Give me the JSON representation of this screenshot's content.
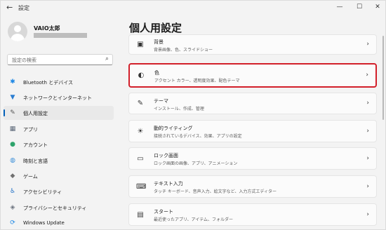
{
  "titlebar": {
    "title": "設定",
    "back": "←",
    "minimize": "—",
    "maximize": "☐",
    "close": "✕"
  },
  "profile": {
    "name": "VAIO太郎"
  },
  "search": {
    "placeholder": "設定の検索",
    "icon": "⌕"
  },
  "sidebar": {
    "items": [
      {
        "label": "Bluetooth とデバイス",
        "icon": "✱",
        "color": "#1e88e5"
      },
      {
        "label": "ネットワークとインターネット",
        "icon": "▼",
        "color": "#2a7dd1"
      },
      {
        "label": "個人用設定",
        "icon": "✎",
        "color": "#555555"
      },
      {
        "label": "アプリ",
        "icon": "▦",
        "color": "#5a6677"
      },
      {
        "label": "アカウント",
        "icon": "●",
        "color": "#2ea36b"
      },
      {
        "label": "時刻と言語",
        "icon": "◍",
        "color": "#3b8fd9"
      },
      {
        "label": "ゲーム",
        "icon": "◆",
        "color": "#707070"
      },
      {
        "label": "アクセシビリティ",
        "icon": "♿",
        "color": "#1f6fc6"
      },
      {
        "label": "プライバシーとセキュリティ",
        "icon": "◈",
        "color": "#6e7580"
      },
      {
        "label": "Windows Update",
        "icon": "⟳",
        "color": "#1e88e5"
      }
    ]
  },
  "main": {
    "title": "個人用設定",
    "cards": [
      {
        "title": "背景",
        "sub": "背景画像、色、スライドショー",
        "icon": "▣"
      },
      {
        "title": "色",
        "sub": "アクセント カラー、透明度効果、配色テーマ",
        "icon": "◐"
      },
      {
        "title": "テーマ",
        "sub": "インストール、作成、管理",
        "icon": "✎"
      },
      {
        "title": "動的ライティング",
        "sub": "接続されているデバイス、効果、アプリの設定",
        "icon": "☀"
      },
      {
        "title": "ロック画面",
        "sub": "ロック画面の画像、アプリ、アニメーション",
        "icon": "▭"
      },
      {
        "title": "テキスト入力",
        "sub": "タッチ キーボード、音声入力、絵文字など、入力方式エディター",
        "icon": "⌨"
      },
      {
        "title": "スタート",
        "sub": "最近使ったアプリ、アイテム、フォルダー",
        "icon": "▤"
      }
    ],
    "chevron": "›"
  },
  "colors": {
    "accent": "#005fb8",
    "highlight": "#d21f2a"
  }
}
